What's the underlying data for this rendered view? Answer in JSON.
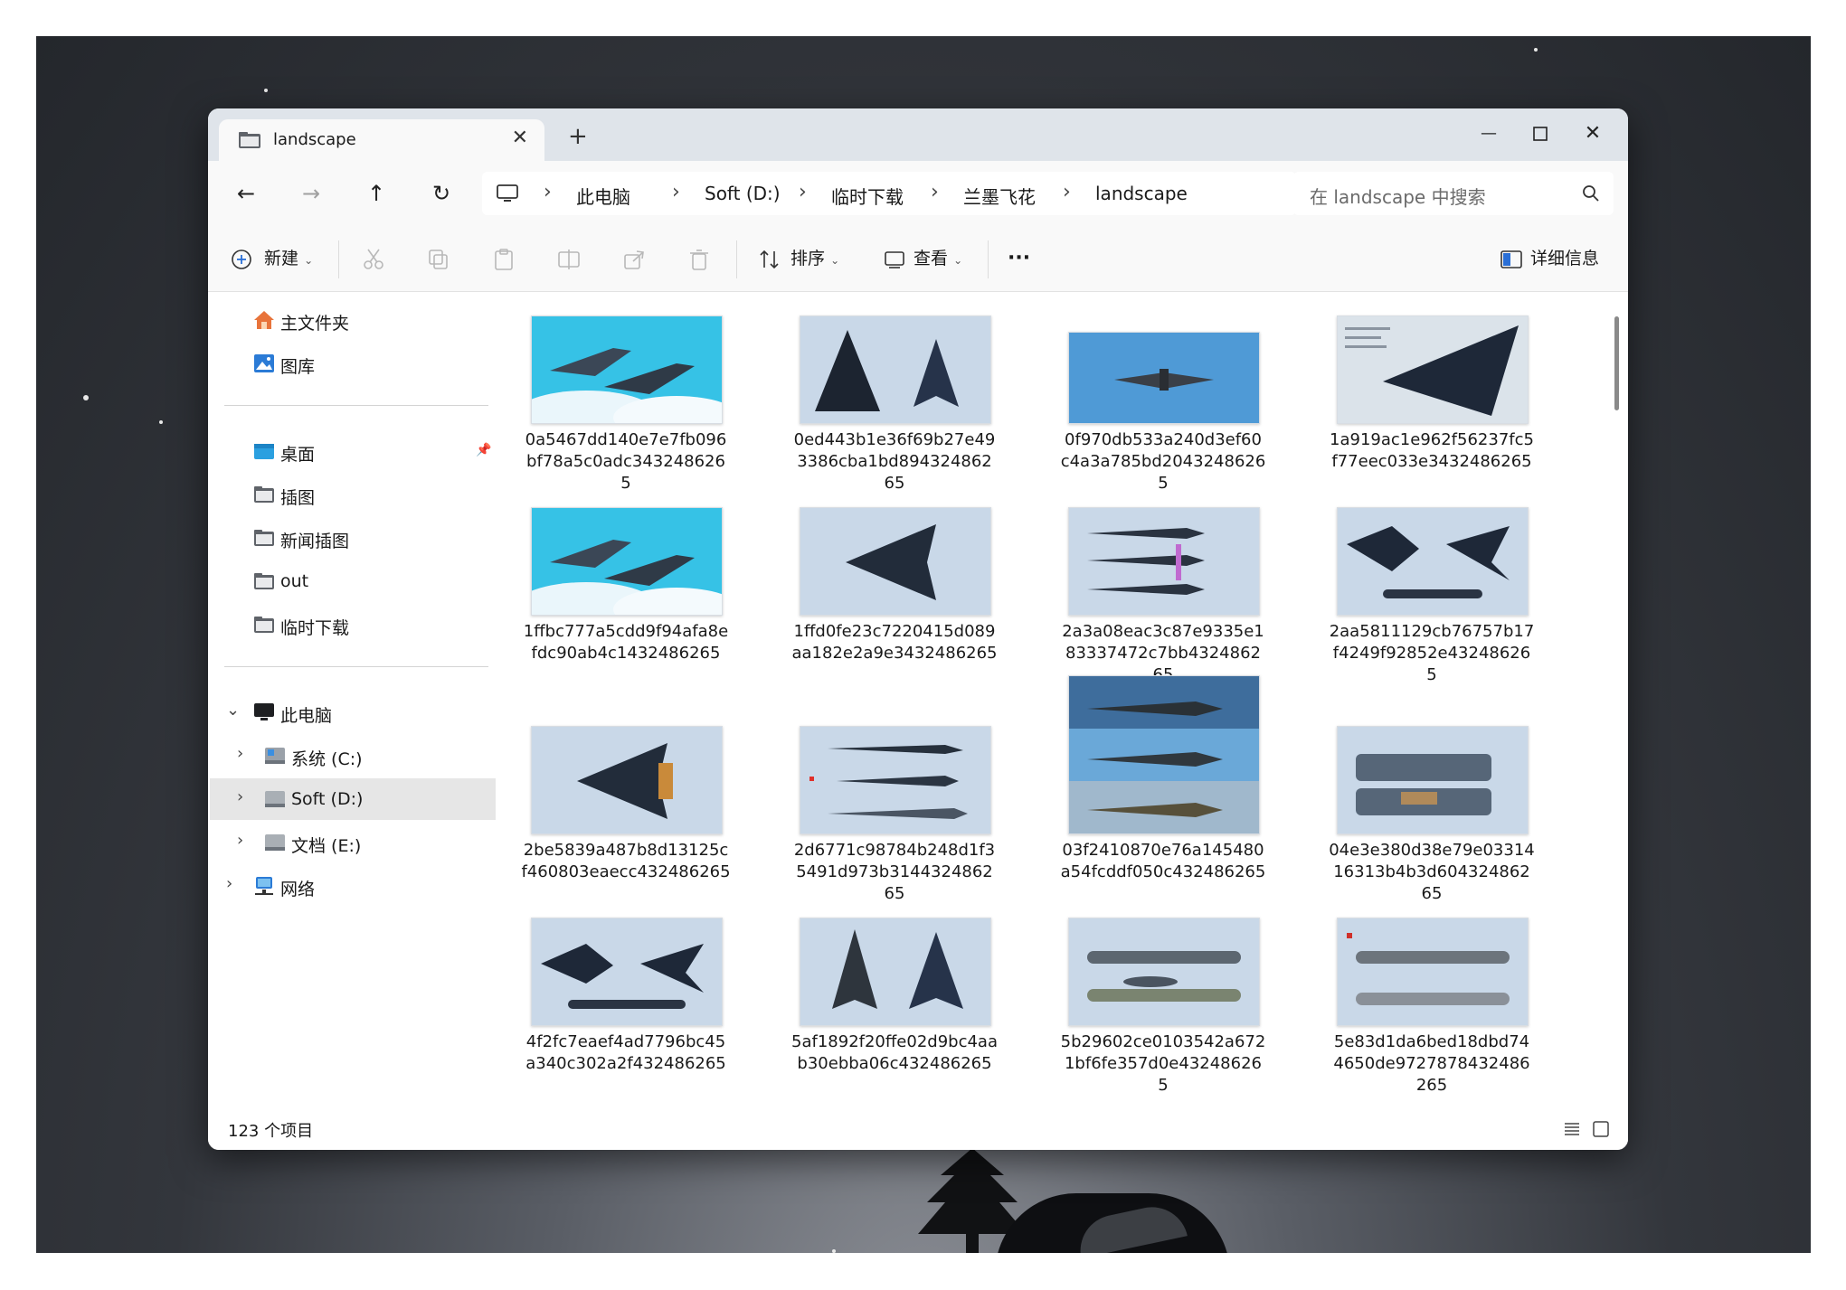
{
  "window": {
    "tab_title": "landscape",
    "tab_close": "✕",
    "tab_add": "+",
    "minimize": "—",
    "close": "✕"
  },
  "nav": {
    "back": "←",
    "forward": "→",
    "up": "↑",
    "refresh": "↻",
    "breadcrumb": [
      "此电脑",
      "Soft (D:)",
      "临时下载",
      "兰墨飞花",
      "landscape"
    ],
    "separator": "›",
    "search_placeholder": "在 landscape 中搜索"
  },
  "toolbar": {
    "new_label": "新建",
    "sort_label": "排序",
    "view_label": "查看",
    "more": "···",
    "details_label": "详细信息"
  },
  "sidebar": {
    "quick": [
      {
        "label": "主文件夹",
        "icon": "home-icon"
      },
      {
        "label": "图库",
        "icon": "gallery-icon"
      }
    ],
    "pinned": [
      {
        "label": "桌面",
        "icon": "desktop-folder-icon"
      },
      {
        "label": "插图",
        "icon": "folder-icon"
      },
      {
        "label": "新闻插图",
        "icon": "folder-icon"
      },
      {
        "label": "out",
        "icon": "folder-icon"
      },
      {
        "label": "临时下载",
        "icon": "folder-icon"
      }
    ],
    "tree": [
      {
        "label": "此电脑",
        "icon": "computer-icon",
        "expanded": true
      },
      {
        "label": "系统 (C:)",
        "icon": "system-drive-icon"
      },
      {
        "label": "Soft (D:)",
        "icon": "drive-icon",
        "selected": true
      },
      {
        "label": "文档 (E:)",
        "icon": "drive-icon"
      },
      {
        "label": "网络",
        "icon": "network-icon"
      }
    ]
  },
  "files": [
    {
      "name": "0a5467dd140e7e7fb096bf78a5c0adc3432486265",
      "lines": [
        "0a5467dd140e7e7fb096",
        "bf78a5c0adc343248626",
        "5"
      ],
      "kind": "sky"
    },
    {
      "name": "0ed443b1e36f69b27e493386cba1bd89432486265",
      "lines": [
        "0ed443b1e36f69b27e49",
        "3386cba1bd894324862",
        "65"
      ],
      "kind": "blueprint"
    },
    {
      "name": "0f970db533a240d3ef60c4a3a785bd2043248626 5",
      "lines": [
        "0f970db533a240d3ef60",
        "c4a3a785bd2043248626",
        "5"
      ],
      "kind": "front"
    },
    {
      "name": "1a919ac1e962f56237fc5f77eec033e3432486265",
      "lines": [
        "1a919ac1e962f56237fc5",
        "f77eec033e3432486265"
      ],
      "kind": "spec"
    },
    {
      "name": "1ffbc777a5cdd9f94afa8efdc90ab4c1432486265",
      "lines": [
        "1ffbc777a5cdd9f94afa8e",
        "fdc90ab4c1432486265"
      ],
      "kind": "sky"
    },
    {
      "name": "1ffd0fe23c7220415d089aa182e2a9e3432486265",
      "lines": [
        "1ffd0fe23c7220415d089",
        "aa182e2a9e3432486265"
      ],
      "kind": "blueprint"
    },
    {
      "name": "2a3a08eac3c87e9335e183337472c7bb432486265",
      "lines": [
        "2a3a08eac3c87e9335e1",
        "83337472c7bb4324862",
        "65"
      ],
      "kind": "compare"
    },
    {
      "name": "2aa5811129cb76757b17f4249f92852e432486265",
      "lines": [
        "2aa5811129cb76757b17",
        "f4249f92852e43248626",
        "5"
      ],
      "kind": "blueprint"
    },
    {
      "name": "2be5839a487b8d13125cf460803eaecc432486265",
      "lines": [
        "2be5839a487b8d13125c",
        "f460803eaecc432486265"
      ],
      "kind": "blueprint"
    },
    {
      "name": "2d6771c98784b248d1f35491d973b314432486265",
      "lines": [
        "2d6771c98784b248d1f3",
        "5491d973b3144324862",
        "65"
      ],
      "kind": "compare"
    },
    {
      "name": "03f2410870e76a145480a54fcddf050c432486265",
      "lines": [
        "03f2410870e76a145480",
        "a54fcddf050c432486265"
      ],
      "kind": "tall"
    },
    {
      "name": "04e3e380d38e79e0331416313b4b3d60432486265",
      "lines": [
        "04e3e380d38e79e03314",
        "16313b4b3d604324862",
        "65"
      ],
      "kind": "carrier"
    },
    {
      "name": "4f2fc7eaef4ad7796bc45a340c302a2f432486265",
      "lines": [
        "4f2fc7eaef4ad7796bc45",
        "a340c302a2f432486265"
      ],
      "kind": "blueprint"
    },
    {
      "name": "5af1892f20ffe02d9bc4aab30ebba06c432486265",
      "lines": [
        "5af1892f20ffe02d9bc4aa",
        "b30ebba06c432486265"
      ],
      "kind": "blueprint"
    },
    {
      "name": "5b29602ce0103542a6721bf6fe357d0e432486265",
      "lines": [
        "5b29602ce0103542a672",
        "1bf6fe357d0e43248626",
        "5"
      ],
      "kind": "awacs"
    },
    {
      "name": "5e83d1da6bed18dbd744650de9727878432486265",
      "lines": [
        "5e83d1da6bed18dbd74",
        "4650de9727878432486",
        "265"
      ],
      "kind": "awacs"
    }
  ],
  "status": {
    "count_text": "123 个项目"
  }
}
